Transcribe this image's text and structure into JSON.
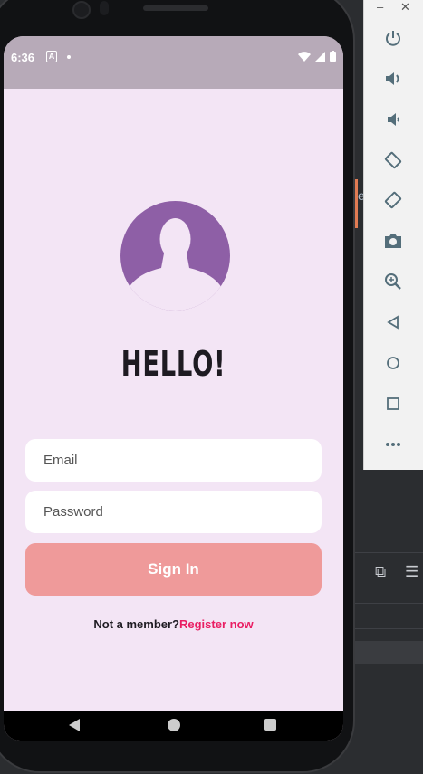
{
  "status_bar": {
    "time": "6:36",
    "notification_letter": "A"
  },
  "login": {
    "title": "HELLO!",
    "email_placeholder": "Email",
    "password_placeholder": "Password",
    "sign_in_label": "Sign In",
    "not_member_text": "Not a member?",
    "register_link": "Register now"
  },
  "emulator_toolbar": {
    "window_controls": [
      "minimize-icon",
      "close-icon"
    ],
    "buttons": [
      "power-icon",
      "volume-up-icon",
      "volume-down-icon",
      "rotate-left-icon",
      "rotate-right-icon",
      "camera-icon",
      "zoom-icon",
      "back-icon",
      "home-icon",
      "overview-icon",
      "more-icon"
    ]
  },
  "ide": {
    "partial_letter": "e"
  },
  "colors": {
    "screen_bg": "#f3e5f5",
    "avatar": "#8e5fa6",
    "button": "#ef9a9a",
    "link": "#e91e63"
  }
}
